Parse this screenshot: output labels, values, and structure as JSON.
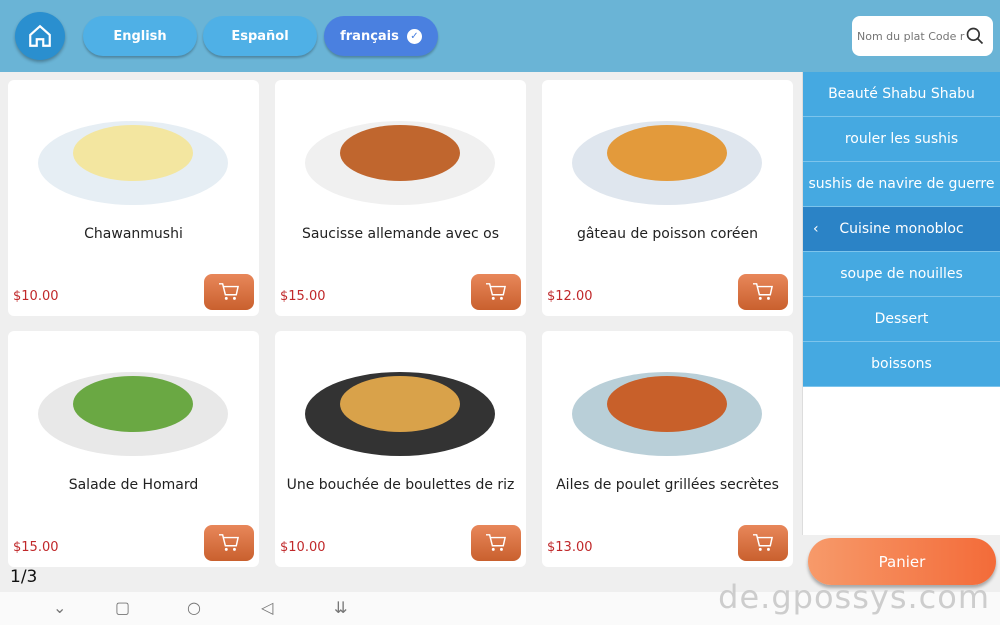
{
  "header": {
    "languages": [
      {
        "label": "English",
        "active": false
      },
      {
        "label": "Español",
        "active": false
      },
      {
        "label": "français",
        "active": true
      }
    ],
    "search_placeholder": "Nom du plat Code r"
  },
  "dishes": [
    {
      "name": "Chawanmushi",
      "price": "$10.00"
    },
    {
      "name": "Saucisse allemande avec os",
      "price": "$15.00"
    },
    {
      "name": "gâteau de poisson coréen",
      "price": "$12.00"
    },
    {
      "name": "Salade de Homard",
      "price": "$15.00"
    },
    {
      "name": "Une bouchée de boulettes de riz",
      "price": "$10.00"
    },
    {
      "name": "Ailes de poulet grillées secrètes",
      "price": "$13.00"
    }
  ],
  "categories": [
    "Beauté Shabu Shabu",
    "rouler les sushis",
    "sushis de navire de guerre",
    "Cuisine monobloc",
    "soupe de nouilles",
    "Dessert",
    "boissons"
  ],
  "active_category": "Cuisine monobloc",
  "cart_label": "Panier",
  "pagination": "1/3",
  "watermark": "de.gpossys.com",
  "colors": {
    "header": "#6ab4d6",
    "price": "#c0282a",
    "cart": "#d46e3c",
    "active_lang": "#4a80e0"
  }
}
